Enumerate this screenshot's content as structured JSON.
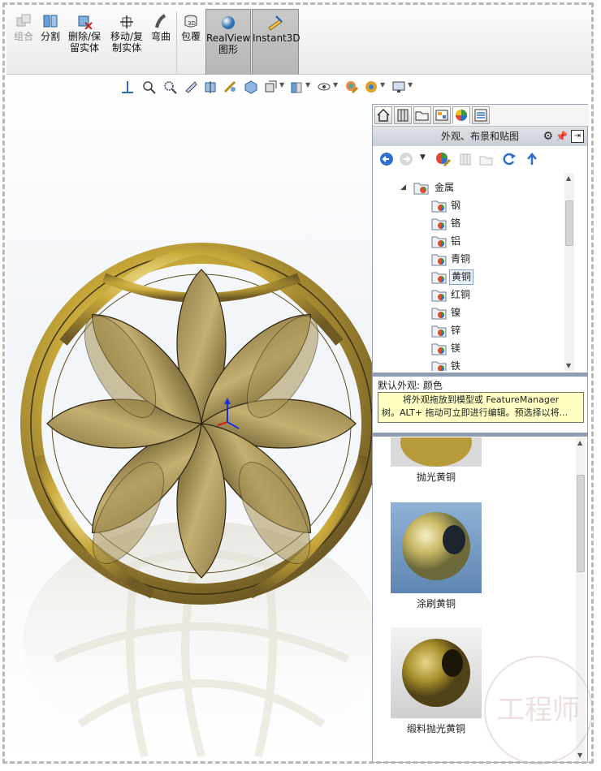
{
  "toolbar": {
    "combine": "组合",
    "split": "分割",
    "delete_keep_l1": "删除/保",
    "delete_keep_l2": "留实体",
    "move_copy_l1": "移动/复",
    "move_copy_l2": "制实体",
    "flex": "弯曲",
    "wrap": "包覆",
    "realview_l1": "RealView",
    "realview_l2": "图形",
    "instant3d": "Instant3D"
  },
  "task_pane": {
    "title": "外观、布景和贴图",
    "tree": {
      "root": "金属",
      "items": [
        "钢",
        "铬",
        "铝",
        "青铜",
        "黄铜",
        "红铜",
        "镍",
        "锌",
        "镁",
        "铁"
      ],
      "selected": "黄铜"
    },
    "default_appearance": "默认外观: 颜色",
    "tooltip_line1": "将外观拖放到模型或 FeatureManager",
    "tooltip_line2": "树。ALT+ 拖动可立即进行编辑。预选择以将...",
    "swatches": [
      "抛光黄铜",
      "涂刷黄铜",
      "缎料抛光黄铜"
    ]
  },
  "watermark": "工程师",
  "colors": {
    "brass_light": "#f2e07a",
    "brass_mid": "#c9a93a",
    "brass_dark": "#6e5a25",
    "selection": "#7da2ce",
    "tooltip_bg": "#ffffc4"
  }
}
